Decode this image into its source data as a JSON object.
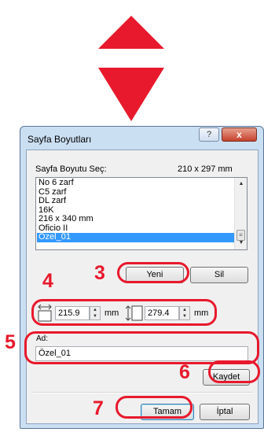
{
  "arrows": {
    "color": "#e8192c"
  },
  "dialog": {
    "title": "Sayfa Boyutları",
    "help_label": "?",
    "close_label": "x",
    "list_label": "Sayfa Boyutu Seç:",
    "current_size": "210 x 297 mm",
    "items": [
      {
        "label": "No 6 zarf"
      },
      {
        "label": "C5 zarf"
      },
      {
        "label": "DL zarf"
      },
      {
        "label": "16K"
      },
      {
        "label": "216 x 340 mm"
      },
      {
        "label": "Oficio II"
      },
      {
        "label": "Özel_01"
      }
    ],
    "selected_index": 6,
    "new_button": "Yeni",
    "delete_button": "Sil",
    "width_value": "215.9",
    "width_unit": "mm",
    "height_value": "279.4",
    "height_unit": "mm",
    "name_label": "Ad:",
    "name_value": "Özel_01",
    "save_button": "Kaydet",
    "ok_button": "Tamam",
    "cancel_button": "İptal"
  },
  "callouts": {
    "color": "#e8192c",
    "steps": [
      "3",
      "4",
      "5",
      "6",
      "7"
    ]
  }
}
